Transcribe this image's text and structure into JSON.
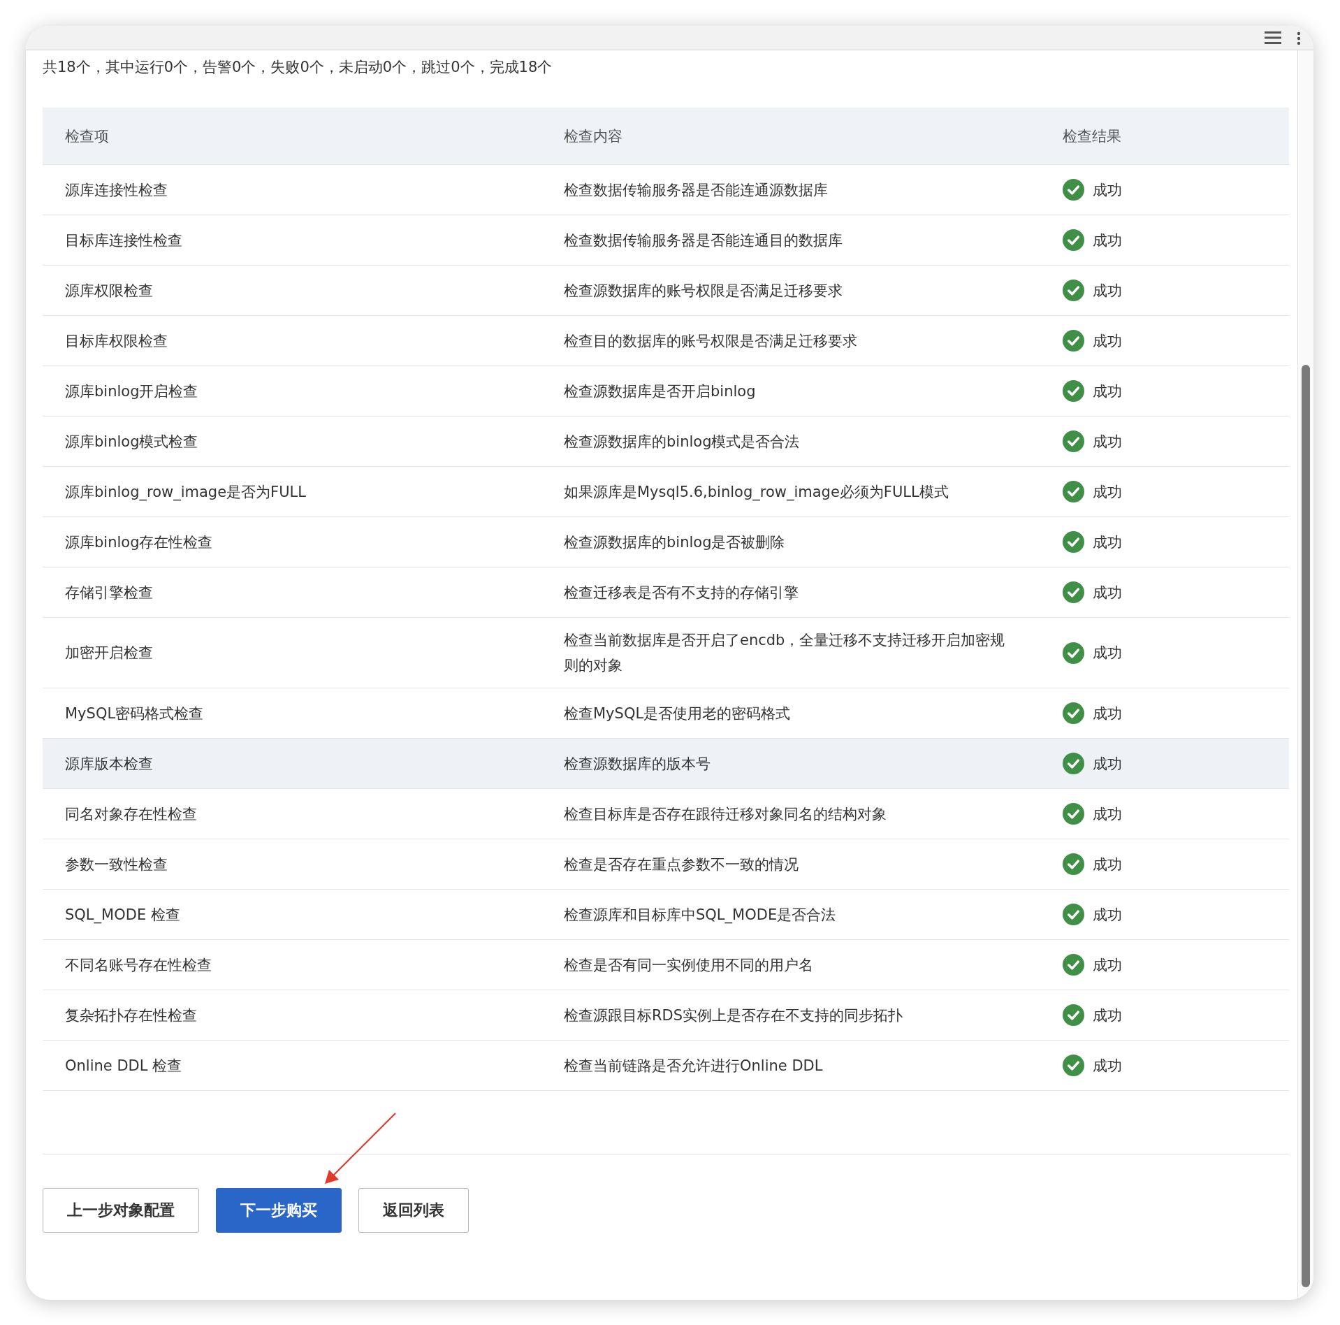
{
  "summary": "共18个，其中运行0个，告警0个，失败0个，未启动0个，跳过0个，完成18个",
  "table": {
    "columns": [
      "检查项",
      "检查内容",
      "检查结果"
    ],
    "rows": [
      {
        "item": "源库连接性检查",
        "content": "检查数据传输服务器是否能连通源数据库",
        "result": "成功",
        "highlighted": false
      },
      {
        "item": "目标库连接性检查",
        "content": "检查数据传输服务器是否能连通目的数据库",
        "result": "成功",
        "highlighted": false
      },
      {
        "item": "源库权限检查",
        "content": "检查源数据库的账号权限是否满足迁移要求",
        "result": "成功",
        "highlighted": false
      },
      {
        "item": "目标库权限检查",
        "content": "检查目的数据库的账号权限是否满足迁移要求",
        "result": "成功",
        "highlighted": false
      },
      {
        "item": "源库binlog开启检查",
        "content": "检查源数据库是否开启binlog",
        "result": "成功",
        "highlighted": false
      },
      {
        "item": "源库binlog模式检查",
        "content": "检查源数据库的binlog模式是否合法",
        "result": "成功",
        "highlighted": false
      },
      {
        "item": "源库binlog_row_image是否为FULL",
        "content": "如果源库是Mysql5.6,binlog_row_image必须为FULL模式",
        "result": "成功",
        "highlighted": false
      },
      {
        "item": "源库binlog存在性检查",
        "content": "检查源数据库的binlog是否被删除",
        "result": "成功",
        "highlighted": false
      },
      {
        "item": "存储引擎检查",
        "content": "检查迁移表是否有不支持的存储引擎",
        "result": "成功",
        "highlighted": false
      },
      {
        "item": "加密开启检查",
        "content": "检查当前数据库是否开启了encdb，全量迁移不支持迁移开启加密规则的对象",
        "result": "成功",
        "highlighted": false
      },
      {
        "item": "MySQL密码格式检查",
        "content": "检查MySQL是否使用老的密码格式",
        "result": "成功",
        "highlighted": false
      },
      {
        "item": "源库版本检查",
        "content": "检查源数据库的版本号",
        "result": "成功",
        "highlighted": true
      },
      {
        "item": "同名对象存在性检查",
        "content": "检查目标库是否存在跟待迁移对象同名的结构对象",
        "result": "成功",
        "highlighted": false
      },
      {
        "item": "参数一致性检查",
        "content": "检查是否存在重点参数不一致的情况",
        "result": "成功",
        "highlighted": false
      },
      {
        "item": "SQL_MODE 检查",
        "content": "检查源库和目标库中SQL_MODE是否合法",
        "result": "成功",
        "highlighted": false
      },
      {
        "item": "不同名账号存在性检查",
        "content": "检查是否有同一实例使用不同的用户名",
        "result": "成功",
        "highlighted": false
      },
      {
        "item": "复杂拓扑存在性检查",
        "content": "检查源跟目标RDS实例上是否存在不支持的同步拓扑",
        "result": "成功",
        "highlighted": false
      },
      {
        "item": "Online DDL 检查",
        "content": "检查当前链路是否允许进行Online DDL",
        "result": "成功",
        "highlighted": false
      }
    ]
  },
  "buttons": [
    {
      "label": "上一步对象配置",
      "kind": "default"
    },
    {
      "label": "下一步购买",
      "kind": "primary"
    },
    {
      "label": "返回列表",
      "kind": "default"
    }
  ]
}
